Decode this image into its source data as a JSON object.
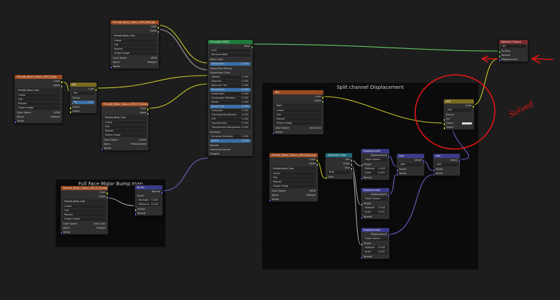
{
  "frames": {
    "full_face": "Full Face Major Bump map",
    "split": "Split channel Displacement"
  },
  "nodes": {
    "img_top": {
      "header": "Female_Base_Colour_SSS_Diff.jpg",
      "filename": "Female_Base_Colo",
      "rows": [
        "Linear",
        "Flat",
        "Repeat",
        "Single Image"
      ],
      "colorspace_label": "Color Space",
      "colorspace": "sRGB",
      "alpha_label": "Alpha",
      "alpha": "Straight",
      "vector": "Vector",
      "out_color": "Color",
      "out_alpha": "Alpha"
    },
    "img_left": {
      "header": "Female_Base_Colour_SSS_R.jpg",
      "filename": "Female_Base_Colo",
      "rows": [
        "Linear",
        "Flat",
        "Repeat",
        "Single Image"
      ],
      "colorspace_label": "Color Space",
      "colorspace": "sRGB",
      "alpha_label": "Alpha",
      "alpha": "Straight",
      "vector": "Vector",
      "out_color": "Color",
      "out_alpha": "Alpha"
    },
    "mix": {
      "header": "Mix",
      "out": "Color",
      "mode": "Mix",
      "clamp": "Clamp",
      "fac": "Fac",
      "fac_val": "0.5",
      "color1": "Color1",
      "color2": "Color2"
    },
    "img_mid": {
      "header": "Female_Base_Colour_SSS_R_Subsurface",
      "filename": "Female_Base_Colo",
      "rows": [
        "Linear",
        "Flat",
        "Repeat",
        "Single Image"
      ],
      "colorspace_label": "Color Space",
      "colorspace": "Linear",
      "alpha_label": "Alpha",
      "alpha": "Premultiplied",
      "vector": "Vector",
      "out_color": "Color",
      "out_alpha": "Alpha"
    },
    "bsdf": {
      "header": "Principled BSDF",
      "out": "BSDF",
      "dist": "GGX",
      "sss": "Random Walk",
      "inputs": [
        {
          "l": "Base Color",
          "v": ""
        },
        {
          "l": "Subsurface",
          "v": "0.000"
        },
        {
          "l": "Subsurface Radius",
          "v": ""
        },
        {
          "l": "Subsurface Color",
          "v": ""
        },
        {
          "l": "Metallic",
          "v": "0.000"
        },
        {
          "l": "Specular",
          "v": "0.500"
        },
        {
          "l": "Specular Tint",
          "v": "0.000"
        },
        {
          "l": "Roughness",
          "v": "0.500"
        },
        {
          "l": "Anisotropic",
          "v": "0.000"
        },
        {
          "l": "Anisotropic Rotation",
          "v": "0.000"
        },
        {
          "l": "Sheen",
          "v": "0.000"
        },
        {
          "l": "Sheen Tint",
          "v": "0.500"
        },
        {
          "l": "Clearcoat",
          "v": "0.000"
        },
        {
          "l": "Clearcoat Roughness",
          "v": "0.030"
        },
        {
          "l": "IOR",
          "v": "1.450"
        },
        {
          "l": "Transmission",
          "v": "0.000"
        },
        {
          "l": "Transmission Roughness",
          "v": "0.000"
        },
        {
          "l": "Emission",
          "v": ""
        },
        {
          "l": "Emission Strength",
          "v": "1.000"
        },
        {
          "l": "Alpha",
          "v": "1.000"
        },
        {
          "l": "Normal",
          "v": ""
        },
        {
          "l": "Clearcoat Normal",
          "v": ""
        },
        {
          "l": "Tangent",
          "v": ""
        }
      ]
    },
    "img_bump": {
      "header": "Female_Base_Colour_SSS_R_BumpMap",
      "filename": "Female_Base_Colo",
      "rows": [
        "Linear",
        "Flat",
        "Repeat",
        "Single Image"
      ],
      "colorspace_label": "Color Space",
      "colorspace": "Non-Color",
      "alpha_label": "Alpha",
      "alpha": "Straight",
      "vector": "Vector",
      "out_color": "Color",
      "out_alpha": "Alpha"
    },
    "bump": {
      "header": "Bump",
      "out": "Normal",
      "invert": "Invert",
      "strength": "Strength",
      "strength_val": "0.500",
      "distance": "Distance",
      "distance_val": "0.100",
      "height": "Height",
      "normal": "Normal"
    },
    "img_mix2": {
      "header": "Mix",
      "out_color": "Color",
      "out_alpha": "Alpha",
      "filename": "Mix3",
      "rows": [
        "Linear",
        "Flat",
        "Repeat",
        "Single Image"
      ],
      "colorspace_label": "Color Space",
      "colorspace": "Non-Color",
      "vector": "Vector"
    },
    "img_disp": {
      "header": "Female_Base_Colour_SSS_Disp.png",
      "filename": "Female_Base_Colo",
      "rows": [
        "Linear",
        "Flat",
        "Repeat",
        "Single Image"
      ],
      "colorspace_label": "Color Space",
      "colorspace": "sRGB",
      "alpha_label": "Alpha",
      "alpha": "Straight",
      "vector": "Vector",
      "out_color": "Color",
      "out_alpha": "Alpha"
    },
    "sep": {
      "header": "Separate Color",
      "outs": [
        "Red",
        "Green",
        "Blue"
      ],
      "mode": "RGB",
      "in": "Color"
    },
    "disp1": {
      "header": "Displacement",
      "out": "Displacement",
      "space": "Object Space",
      "height": "Height",
      "midlevel": "Midlevel",
      "midlevel_val": "0.000",
      "scale": "Scale",
      "scale_val": "0.001",
      "normal": "Normal"
    },
    "disp2": {
      "header": "Displacement",
      "out": "Displacement",
      "space": "Object Space",
      "height": "Height",
      "midlevel": "Midlevel",
      "midlevel_val": "0.000",
      "scale": "Scale",
      "scale_val": "0.001",
      "normal": "Normal"
    },
    "disp3": {
      "header": "Displacement",
      "out": "Displacement",
      "space": "Object Space",
      "height": "Height",
      "midlevel": "Midlevel",
      "midlevel_val": "0.000",
      "scale": "Scale",
      "scale_val": "0.001",
      "normal": "Normal"
    },
    "add1": {
      "header": "Add",
      "out": "Vector",
      "op": "Add",
      "v1": "Vector",
      "v2": "Vector"
    },
    "add2": {
      "header": "Add",
      "out": "Vector",
      "op": "Add",
      "v1": "Vector",
      "v2": "Vector"
    },
    "mix_add": {
      "header": "Add",
      "out": "Color",
      "op": "Add",
      "clamp": "Clamp",
      "fac": "Fac",
      "color1": "Color1",
      "color2": "Color2"
    },
    "output": {
      "header": "Material Output",
      "target": "All",
      "surface": "Surface",
      "volume": "Volume",
      "displacement": "Displacement"
    }
  },
  "annotation": {
    "text": "Solved"
  },
  "colors": {
    "color_wire": "#c7c729",
    "float_wire": "#a1a1a1",
    "vector_wire": "#6363c7",
    "shader_wire": "#63c763",
    "annotation": "#e01616"
  }
}
